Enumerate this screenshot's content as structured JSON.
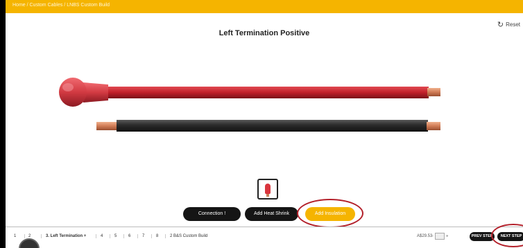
{
  "breadcrumb": "Home / Custom Cables / LNBS Custom Build",
  "reset_label": "Reset",
  "page_title": "Left Termination Positive",
  "buttons": {
    "connection": "Connection !",
    "add_heat_shrink": "Add Heat Shrink",
    "add_insulation": "Add Insulation"
  },
  "steps": [
    {
      "label": "1"
    },
    {
      "label": "2"
    },
    {
      "label": "3. Left Termination +"
    },
    {
      "label": "4"
    },
    {
      "label": "5"
    },
    {
      "label": "6"
    },
    {
      "label": "7"
    },
    {
      "label": "8"
    },
    {
      "label": "2 B&S Custom Build"
    }
  ],
  "price": "A$29.53",
  "quantity": {
    "minus": "-",
    "plus": "+"
  },
  "nav": {
    "prev": "PREV STEP",
    "next": "NEXT STEP"
  },
  "colors": {
    "accent": "#f5b400",
    "red_cable": "#c8242d",
    "black_cable": "#2a2a2a",
    "copper": "#d9886a",
    "annotation": "#b3202a"
  },
  "icons": {
    "reset": "refresh-icon",
    "thumbnail": "lug-boot-icon",
    "chat": "chat-icon"
  }
}
